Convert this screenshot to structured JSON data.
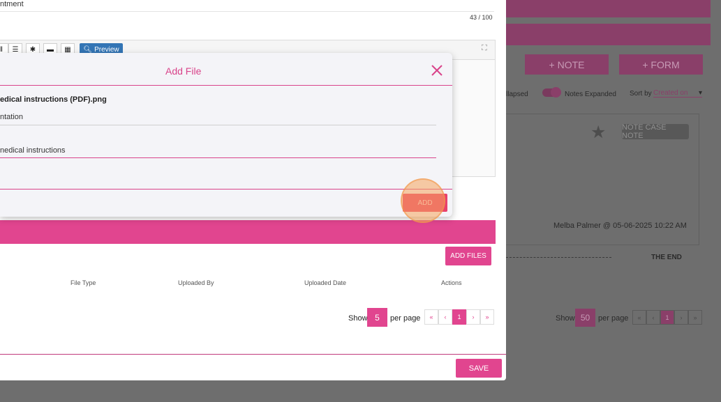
{
  "background_page": {
    "note_button": "+ NOTE",
    "form_button": "+ FORM",
    "collapsed_label": "llapsed",
    "notes_expanded_label": "Notes Expanded",
    "sort_by_label": "Sort by",
    "sort_by_value": "Created on",
    "sort_caret": "▾",
    "note_badge": "NOTE CASE NOTE",
    "note_author": "Melba Palmer @ 05-06-2025 10:22 AM",
    "the_end": "THE END",
    "show_label": "Show",
    "per_page_value": "50",
    "per_page_label": "per page",
    "pager": [
      "«",
      "‹",
      "1",
      "›",
      "»"
    ]
  },
  "modal": {
    "subject_text": "ntment",
    "char_counter": "43 / 100",
    "toolbar_icons": [
      "‖",
      "☰",
      "✱",
      "▬",
      "▦"
    ],
    "preview_button": "Preview",
    "expand_icon": "⛶",
    "add_files_button": "ADD FILES",
    "table_headers": [
      "File Type",
      "Uploaded By",
      "Uploaded Date",
      "Actions"
    ],
    "show_label": "Show",
    "per_page_value": "5",
    "per_page_label": "per page",
    "pager": [
      "«",
      "‹",
      "1",
      "›",
      "»"
    ],
    "save_button": "SAVE"
  },
  "dialog": {
    "title": "Add File",
    "file_name": "edical instructions (PDF).png",
    "field1_value": "ntation",
    "field2_value": "nedical instructions",
    "add_button": "ADD"
  },
  "colors": {
    "accent": "#e1458f",
    "add_button": "#e8426c",
    "dimmed_accent": "#8a3f69"
  }
}
